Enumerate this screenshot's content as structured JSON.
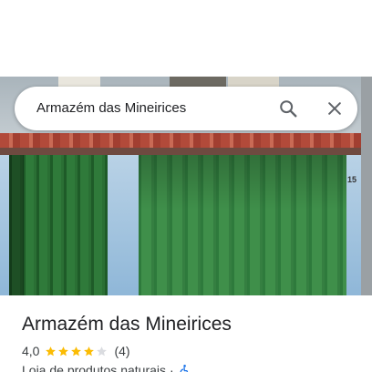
{
  "search": {
    "query": "Armazém das Mineirices"
  },
  "icons": {
    "search": "search-icon",
    "close": "close-icon",
    "accessible": "wheelchair-accessible-icon"
  },
  "photo": {
    "house_number": "15",
    "description_icon": "storefront-photo"
  },
  "place": {
    "name": "Armazém das Mineirices",
    "rating": "4,0",
    "stars_filled": 4,
    "stars_total": 5,
    "review_count": "(4)",
    "category": "Loja de produtos naturais",
    "separator": "·"
  },
  "colors": {
    "star_filled": "#fbbc04",
    "star_empty": "#dadce0",
    "accessible_icon": "#1a73e8",
    "text_primary": "#202124",
    "text_secondary": "#3c4043"
  }
}
